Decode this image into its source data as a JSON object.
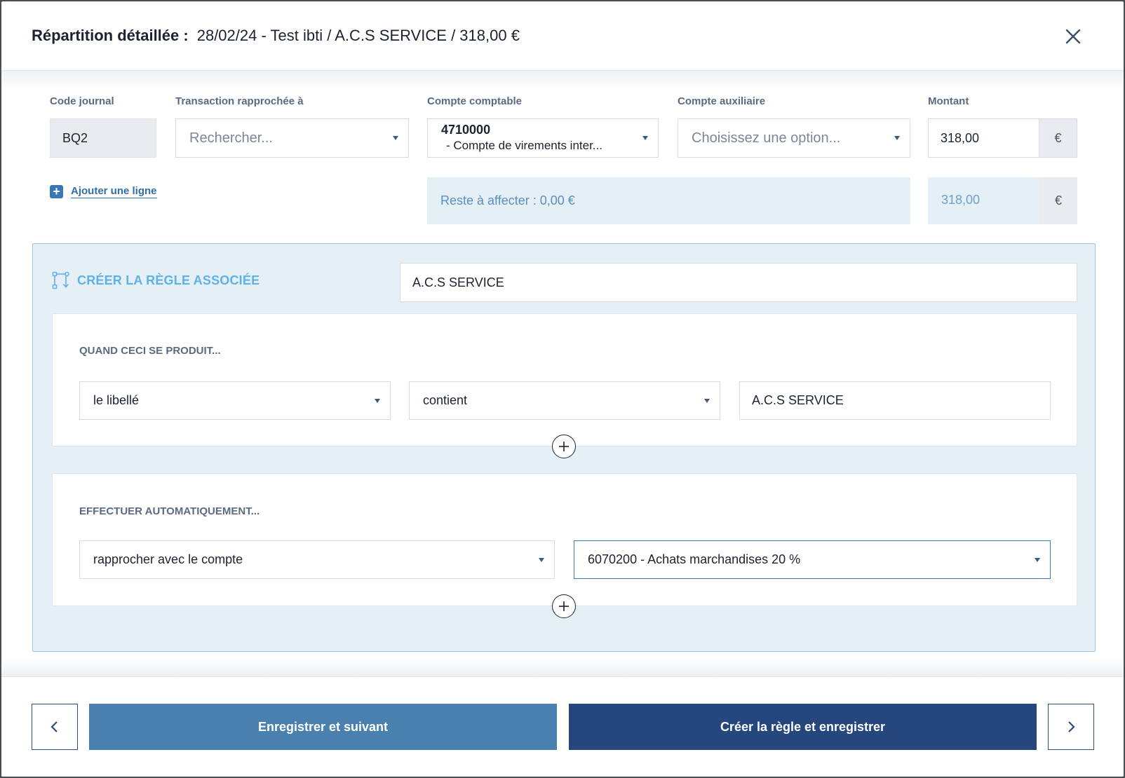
{
  "header": {
    "title_bold": "Répartition détaillée :",
    "title_rest": "28/02/24 - Test ibti / A.C.S SERVICE / 318,00 €",
    "close_icon": "close-icon"
  },
  "form": {
    "labels": {
      "code_journal": "Code journal",
      "transaction": "Transaction rapprochée à",
      "compte_comptable": "Compte comptable",
      "compte_auxiliaire": "Compte auxiliaire",
      "montant": "Montant"
    },
    "code_journal": "BQ2",
    "transaction_placeholder": "Rechercher...",
    "compte_comptable_code": "4710000",
    "compte_comptable_label": "- Compte de virements inter...",
    "compte_auxiliaire_placeholder": "Choisissez une option...",
    "montant": "318,00",
    "currency": "€",
    "add_line": "Ajouter une ligne",
    "reste": "Reste à affecter : 0,00 €",
    "reste_amount": "318,00"
  },
  "rule": {
    "title": "CRÉER LA RÈGLE ASSOCIÉE",
    "name": "A.C.S SERVICE",
    "condition": {
      "title": "QUAND CECI SE PRODUIT...",
      "field": "le libellé",
      "operator": "contient",
      "value": "A.C.S SERVICE"
    },
    "action": {
      "title": "EFFECTUER AUTOMATIQUEMENT...",
      "type": "rapprocher avec le compte",
      "account": "6070200 - Achats marchandises 20 %"
    }
  },
  "footer": {
    "save_next": "Enregistrer et suivant",
    "create_rule_save": "Créer la règle et enregistrer"
  },
  "colors": {
    "accent_dark": "#26467e",
    "accent_light": "#4a80ad",
    "rule_bg": "#e4eff6",
    "rule_title": "#5fb1e6"
  }
}
